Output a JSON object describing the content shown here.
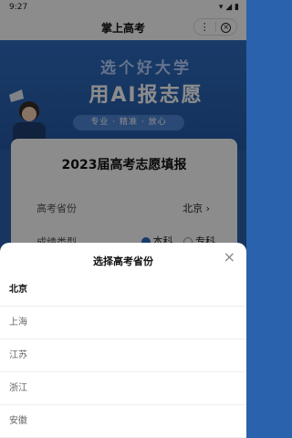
{
  "status": {
    "time": "9:27",
    "icons": "▾ ◢ ▮"
  },
  "nav": {
    "title": "掌上高考",
    "more": "⋮",
    "close": "×"
  },
  "banner": {
    "line1": "选个好大学",
    "line2": "用AI报志愿",
    "tag": "专业 · 精准 · 放心"
  },
  "card": {
    "title": "2023届高考志愿填报",
    "province_label": "高考省份",
    "province_value": "北京",
    "score_type_label": "成绩类型",
    "option_benke": "本科",
    "option_zhuanke": "专科"
  },
  "sheet": {
    "title": "选择高考省份",
    "close": "×",
    "provinces": [
      "北京",
      "上海",
      "江苏",
      "浙江",
      "安徽"
    ]
  }
}
